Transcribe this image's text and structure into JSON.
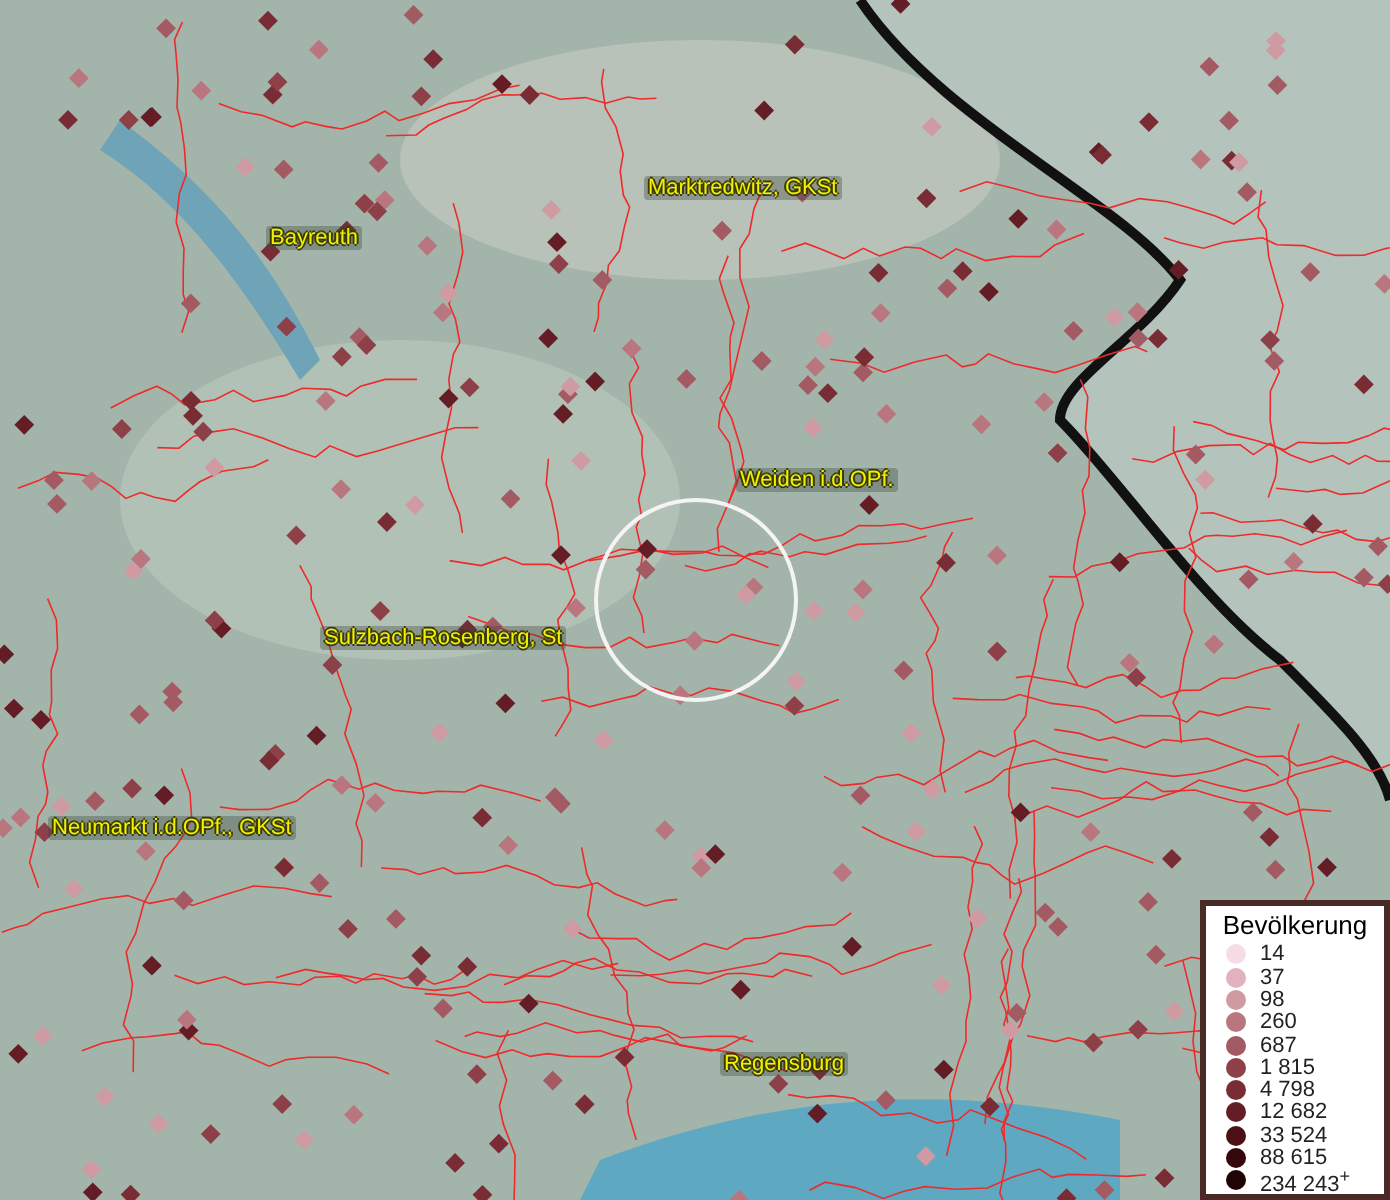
{
  "map": {
    "places": [
      {
        "name": "Marktredwitz, GKSt"
      },
      {
        "name": "Bayreuth"
      },
      {
        "name": "Weiden i.d.OPf."
      },
      {
        "name": "Sulzbach-Rosenberg, St"
      },
      {
        "name": "Neumarkt i.d.OPf., GKSt"
      },
      {
        "name": "Regensburg"
      }
    ]
  },
  "legend": {
    "title": "Bevölkerung",
    "classes": [
      {
        "label": "14",
        "color": "#f5dce6"
      },
      {
        "label": "37",
        "color": "#e2b3bf"
      },
      {
        "label": "98",
        "color": "#cf9aa2"
      },
      {
        "label": "260",
        "color": "#b9767f"
      },
      {
        "label": "687",
        "color": "#a45a63"
      },
      {
        "label": "1 815",
        "color": "#8e4048"
      },
      {
        "label": "4 798",
        "color": "#7a2c35"
      },
      {
        "label": "12 682",
        "color": "#641c25"
      },
      {
        "label": "33 524",
        "color": "#4c1016"
      },
      {
        "label": "88 615",
        "color": "#36070c"
      },
      {
        "label": "234 243$^{+}$",
        "color": "#200305"
      }
    ]
  }
}
